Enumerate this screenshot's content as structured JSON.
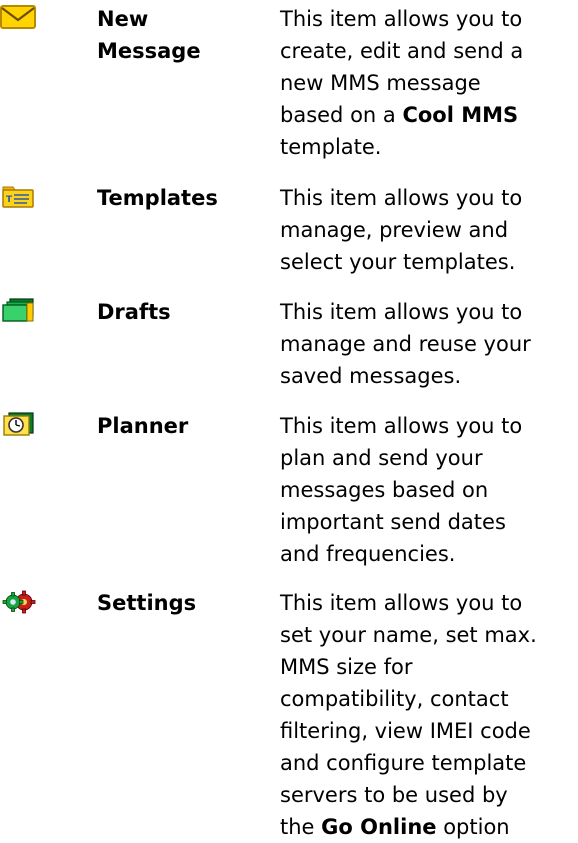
{
  "items": [
    {
      "key": "new-message",
      "icon": "envelope-icon",
      "title_lines": [
        "New",
        "Message"
      ],
      "desc_lines": [
        [
          "This item allows you to"
        ],
        [
          "create, edit and send a"
        ],
        [
          "new MMS message"
        ],
        [
          "based on a ",
          {
            "b": "Cool MMS"
          }
        ],
        [
          "template."
        ]
      ]
    },
    {
      "key": "templates",
      "icon": "template-folder-icon",
      "title_lines": [
        "Templates"
      ],
      "desc_lines": [
        [
          "This item allows you to"
        ],
        [
          "manage, preview and"
        ],
        [
          "select your templates."
        ]
      ]
    },
    {
      "key": "drafts",
      "icon": "drafts-stack-icon",
      "title_lines": [
        "Drafts"
      ],
      "desc_lines": [
        [
          "This item allows you to"
        ],
        [
          "manage and reuse your"
        ],
        [
          "saved messages."
        ]
      ]
    },
    {
      "key": "planner",
      "icon": "clock-folder-icon",
      "title_lines": [
        "Planner"
      ],
      "desc_lines": [
        [
          "This item allows you to"
        ],
        [
          "plan and send your"
        ],
        [
          "messages based on"
        ],
        [
          "important send dates"
        ],
        [
          "and frequencies."
        ]
      ]
    },
    {
      "key": "settings",
      "icon": "gears-icon",
      "title_lines": [
        "Settings"
      ],
      "desc_lines": [
        [
          "This item allows you to"
        ],
        [
          "set your name, set max."
        ],
        [
          "MMS size for"
        ],
        [
          "compatibility, contact"
        ],
        [
          "filtering, view IMEI code"
        ],
        [
          "and configure template"
        ],
        [
          "servers to be used by"
        ],
        [
          "the ",
          {
            "b": "Go Online"
          },
          " option"
        ]
      ]
    }
  ]
}
